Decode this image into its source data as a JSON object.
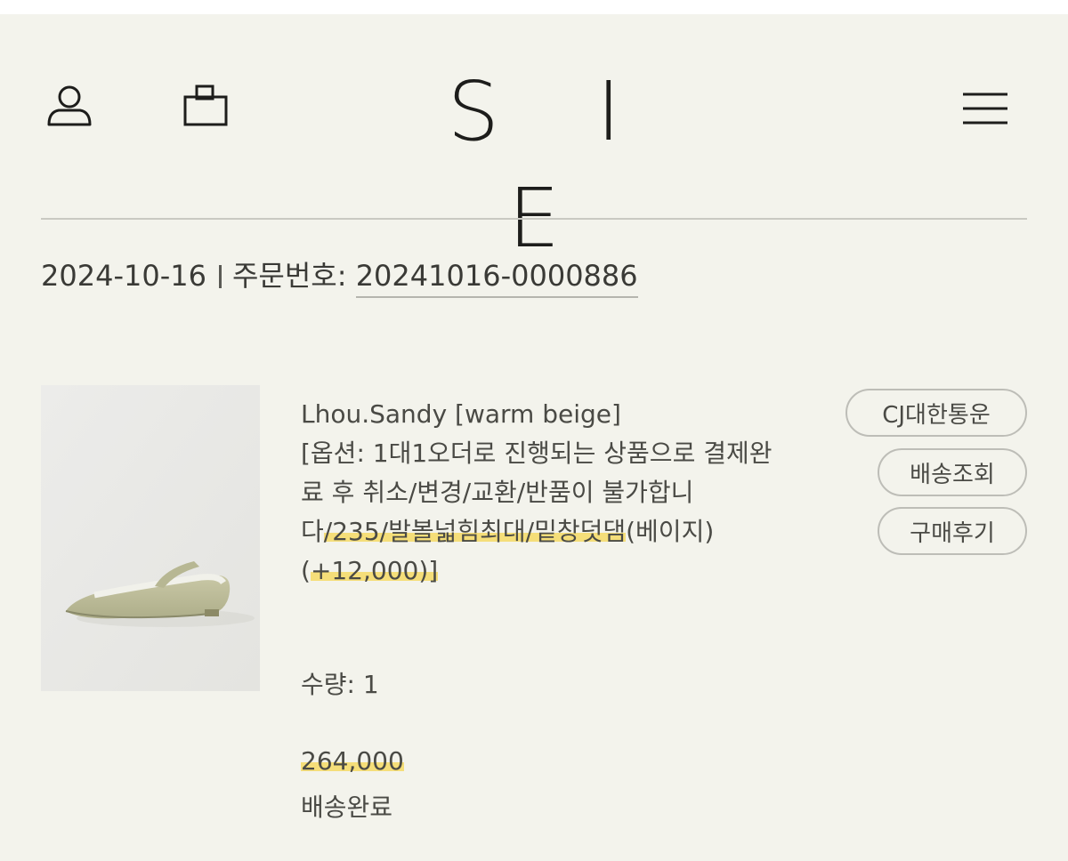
{
  "header": {
    "logo": "S I E"
  },
  "order": {
    "date": "2024-10-16",
    "number_label": "주문번호:",
    "number": "20241016-0000886"
  },
  "product": {
    "name": "Lhou.Sandy [warm beige]",
    "option_part1": "[옵션: 1대1오더로 진행되는 상품으로 결제완료 후 취소/변경/교환/반품이 불가합니다",
    "option_highlight1": "/235/발볼넓힘최대/밑창덧댐",
    "option_part2": "(베이지) (",
    "option_highlight2": "+12,000)]",
    "quantity": "수량: 1",
    "price": "264,000",
    "status": "배송완료",
    "highlight_color": "#f5de79"
  },
  "actions": {
    "courier_label": "CJ대한통운",
    "track_label": "배송조회",
    "review_label": "구매후기"
  },
  "icons": {
    "user": "user-icon",
    "bag": "shopping-bag-icon",
    "menu": "hamburger-menu-icon"
  }
}
